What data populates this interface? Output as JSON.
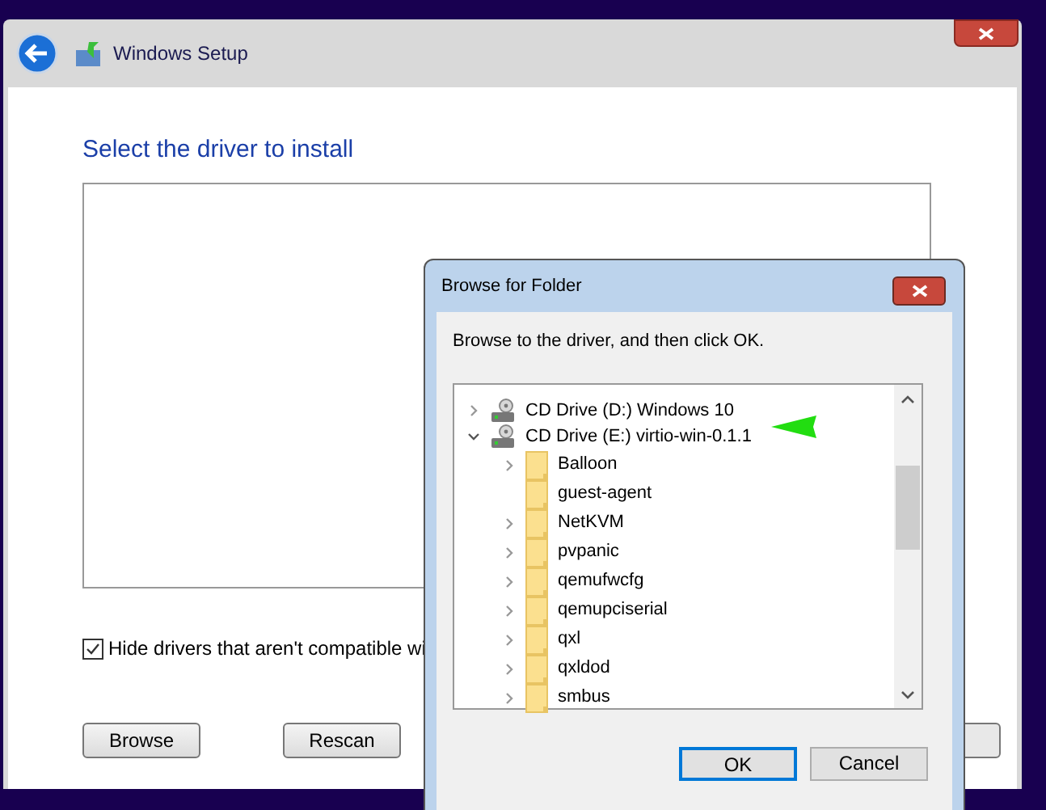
{
  "window": {
    "title": "Windows Setup"
  },
  "heading": "Select the driver to install",
  "hide_incompatible": {
    "label": "Hide drivers that aren't compatible wi",
    "checked": true
  },
  "buttons": [
    "Browse",
    "Rescan"
  ],
  "dialog": {
    "title": "Browse for Folder",
    "instruction": "Browse to the driver, and then click OK.",
    "tree": [
      {
        "label": "CD Drive (D:) Windows 10",
        "kind": "drive",
        "expanded": false,
        "expandable": true
      },
      {
        "label": "CD Drive (E:) virtio-win-0.1.1",
        "kind": "drive",
        "expanded": true,
        "expandable": true,
        "children": [
          {
            "label": "Balloon",
            "kind": "folder",
            "expandable": true
          },
          {
            "label": "guest-agent",
            "kind": "folder",
            "expandable": false
          },
          {
            "label": "NetKVM",
            "kind": "folder",
            "expandable": true
          },
          {
            "label": "pvpanic",
            "kind": "folder",
            "expandable": true
          },
          {
            "label": "qemufwcfg",
            "kind": "folder",
            "expandable": true
          },
          {
            "label": "qemupciserial",
            "kind": "folder",
            "expandable": true
          },
          {
            "label": "qxl",
            "kind": "folder",
            "expandable": true
          },
          {
            "label": "qxldod",
            "kind": "folder",
            "expandable": true
          },
          {
            "label": "smbus",
            "kind": "folder",
            "expandable": true
          }
        ]
      }
    ],
    "buttons": [
      {
        "label": "OK",
        "selected": true
      },
      {
        "label": "Cancel",
        "selected": false
      }
    ]
  }
}
